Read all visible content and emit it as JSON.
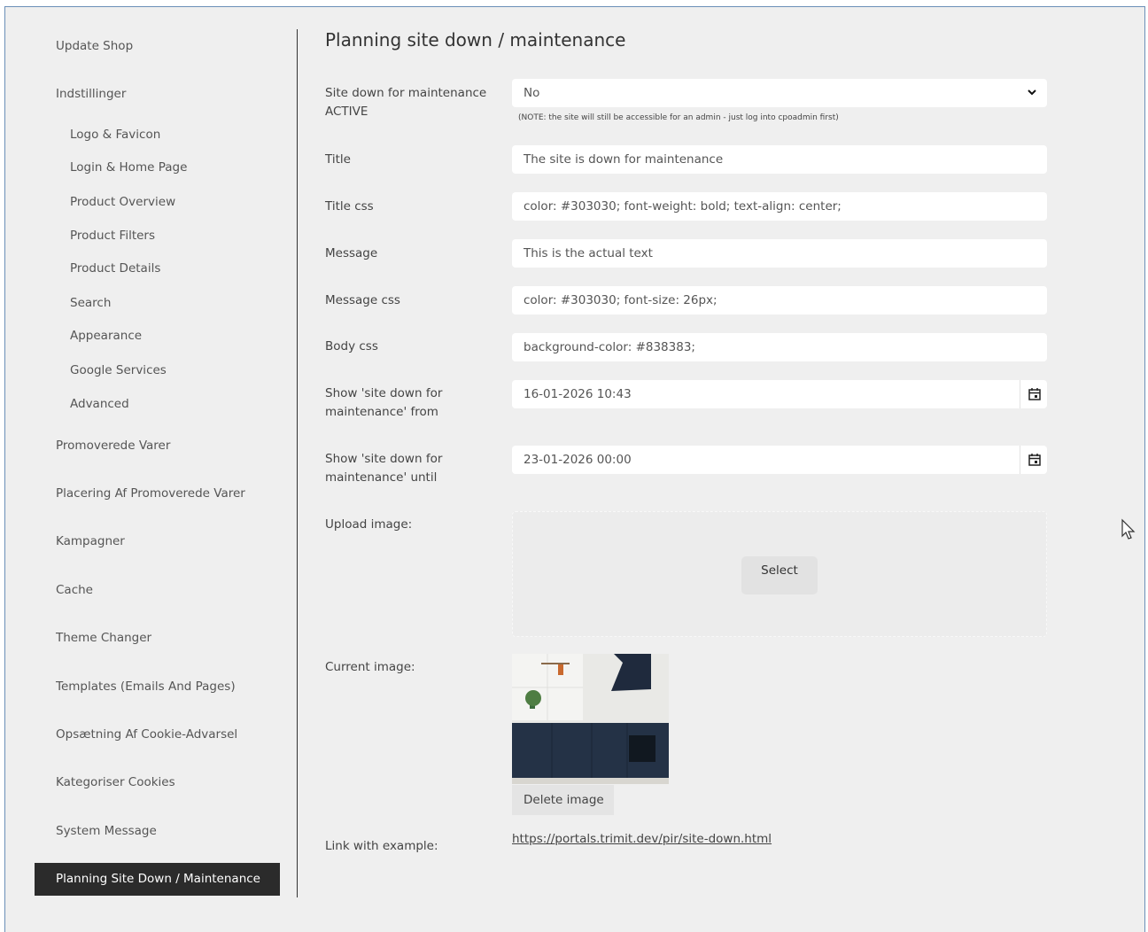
{
  "sidebar": {
    "items": [
      {
        "label": "Update Shop"
      },
      {
        "label": "Indstillinger"
      },
      {
        "label": "Logo & Favicon"
      },
      {
        "label": "Login & Home Page"
      },
      {
        "label": "Product Overview"
      },
      {
        "label": "Product Filters"
      },
      {
        "label": "Product Details"
      },
      {
        "label": "Search"
      },
      {
        "label": "Appearance"
      },
      {
        "label": "Google Services"
      },
      {
        "label": "Advanced"
      },
      {
        "label": "Promoverede Varer"
      },
      {
        "label": "Placering Af Promoverede Varer"
      },
      {
        "label": "Kampagner"
      },
      {
        "label": "Cache"
      },
      {
        "label": "Theme Changer"
      },
      {
        "label": "Templates (Emails And Pages)"
      },
      {
        "label": "Opsætning Af Cookie-Advarsel"
      },
      {
        "label": "Kategoriser Cookies"
      },
      {
        "label": "System Message"
      },
      {
        "label": "Planning Site Down / Maintenance"
      }
    ]
  },
  "main": {
    "title": "Planning site down / maintenance",
    "fields": {
      "active": {
        "label": "Site down for maintenance ACTIVE",
        "value": "No",
        "note": "(NOTE: the site will still be accessible for an admin - just log into cpoadmin first)"
      },
      "title": {
        "label": "Title",
        "value": "The site is down for maintenance"
      },
      "title_css": {
        "label": "Title css",
        "value": "color: #303030; font-weight: bold; text-align: center;"
      },
      "message": {
        "label": "Message",
        "value": "This is the actual text"
      },
      "message_css": {
        "label": "Message css",
        "value": "color: #303030; font-size: 26px;"
      },
      "body_css": {
        "label": "Body css",
        "value": "background-color: #838383;"
      },
      "from": {
        "label": "Show 'site down for maintenance' from",
        "value": "16-01-2026 10:43"
      },
      "until": {
        "label": "Show 'site down for maintenance' until",
        "value": "23-01-2026 00:00"
      },
      "upload": {
        "label": "Upload image:",
        "button": "Select"
      },
      "current": {
        "label": "Current image:",
        "delete_button": "Delete image"
      },
      "link": {
        "label": "Link with example:",
        "url": "https://portals.trimit.dev/pir/site-down.html"
      }
    }
  },
  "colors": {
    "page_bg": "#efefef",
    "active_nav_bg": "#2b2b2b",
    "field_bg": "#ffffff"
  }
}
